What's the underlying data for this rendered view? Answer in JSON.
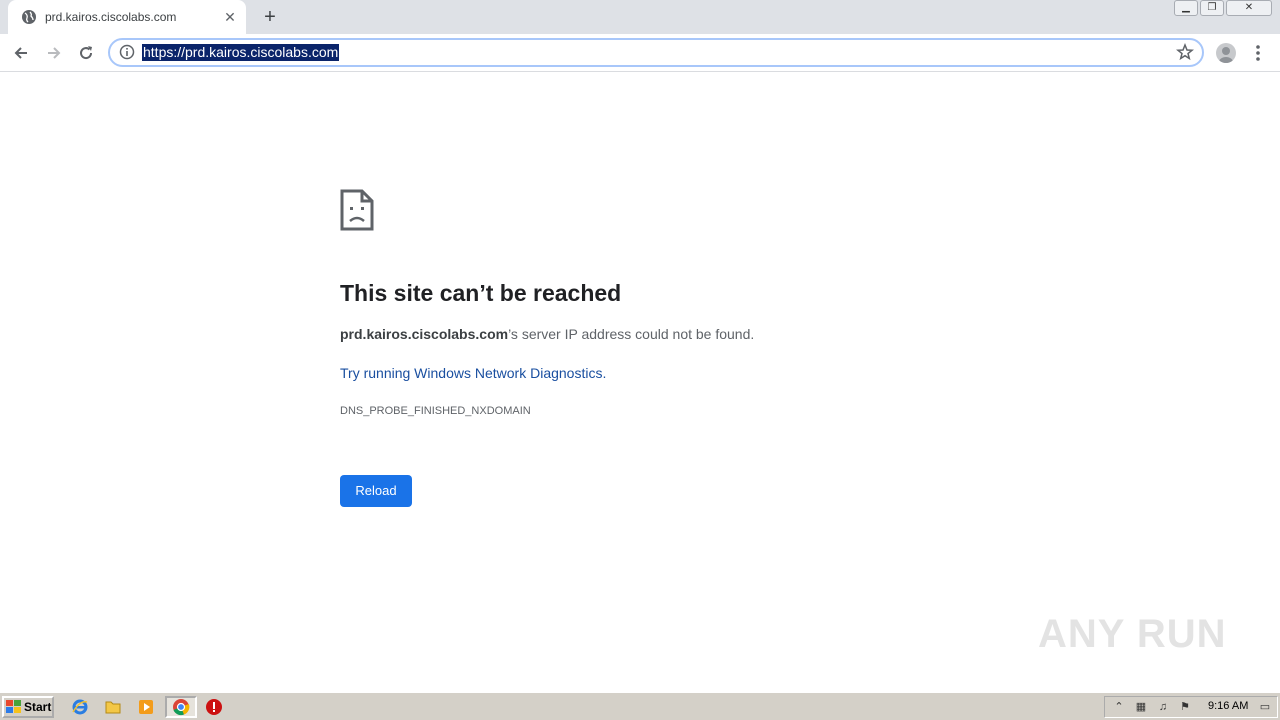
{
  "tab": {
    "title": "prd.kairos.ciscolabs.com"
  },
  "omnibox": {
    "url": "https://prd.kairos.ciscolabs.com"
  },
  "error": {
    "title": "This site can’t be reached",
    "host": "prd.kairos.ciscolabs.com",
    "message_suffix": "’s server IP address could not be found.",
    "diagnostics_link": "Try running Windows Network Diagnostics",
    "diagnostics_period": ".",
    "code": "DNS_PROBE_FINISHED_NXDOMAIN",
    "reload_label": "Reload"
  },
  "watermark": {
    "text": "ANY RUN"
  },
  "taskbar": {
    "start_label": "Start",
    "clock": "9:16 AM"
  },
  "colors": {
    "accent": "#1a73e8",
    "link": "#1a4fa0",
    "selection": "#0a246a"
  }
}
